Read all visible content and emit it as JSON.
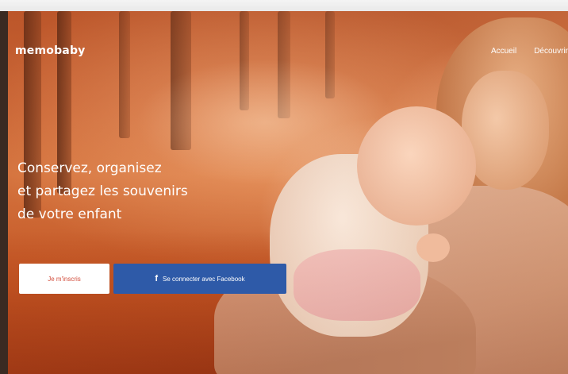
{
  "brand": {
    "logo_text": "memobaby"
  },
  "nav": {
    "items": [
      {
        "label": "Accueil"
      },
      {
        "label": "Découvrir"
      }
    ]
  },
  "hero": {
    "headline_lines": [
      "Conservez, organisez",
      "et partagez les souvenirs",
      "de votre enfant"
    ],
    "signup_button_label": "Je m'inscris",
    "facebook_button_label": "Se connecter avec Facebook",
    "facebook_icon_glyph": "f"
  },
  "colors": {
    "facebook_blue": "#2e5aa8",
    "signup_text": "#d24b3a",
    "hero_tint": "#c8693a"
  }
}
